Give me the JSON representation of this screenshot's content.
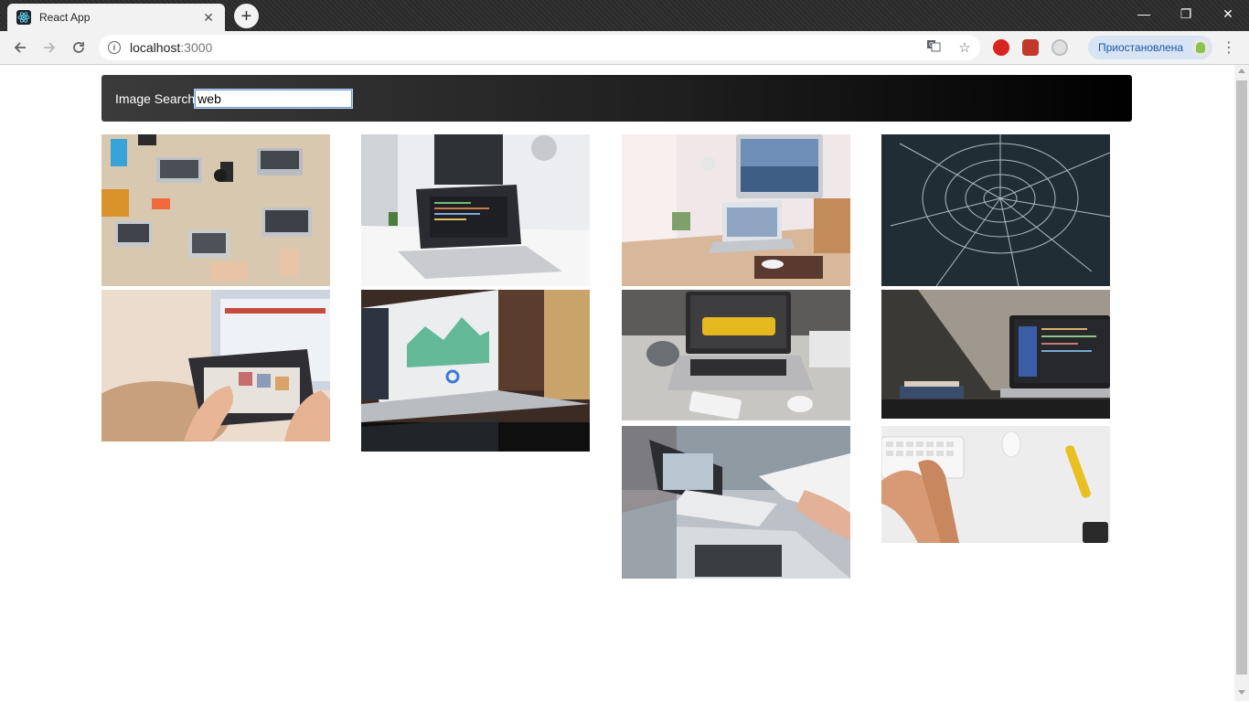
{
  "browser": {
    "tab_title": "React App",
    "new_tab_symbol": "+",
    "url_host": "localhost",
    "url_port": ":3000",
    "profile_label": "Приостановлена",
    "window_controls": {
      "minimize": "—",
      "restore": "❐",
      "close": "✕"
    }
  },
  "search": {
    "label": "Image Search",
    "value": "web"
  },
  "images": [
    {
      "name": "desk-overhead-laptops"
    },
    {
      "name": "laptop-code-desk"
    },
    {
      "name": "imac-workspace"
    },
    {
      "name": "spider-web"
    },
    {
      "name": "tablet-hands"
    },
    {
      "name": "laptop-dashboard"
    },
    {
      "name": "laptop-sofa-product"
    },
    {
      "name": "dark-desk-laptop-code"
    },
    {
      "name": "meeting-laptop-notes"
    },
    {
      "name": "white-keyboard-hands"
    }
  ],
  "colors": {
    "search_bar_start": "#3b3b3b",
    "search_bar_end": "#000000",
    "profile_bg": "#d8e4f4",
    "profile_text": "#1a57a8"
  }
}
